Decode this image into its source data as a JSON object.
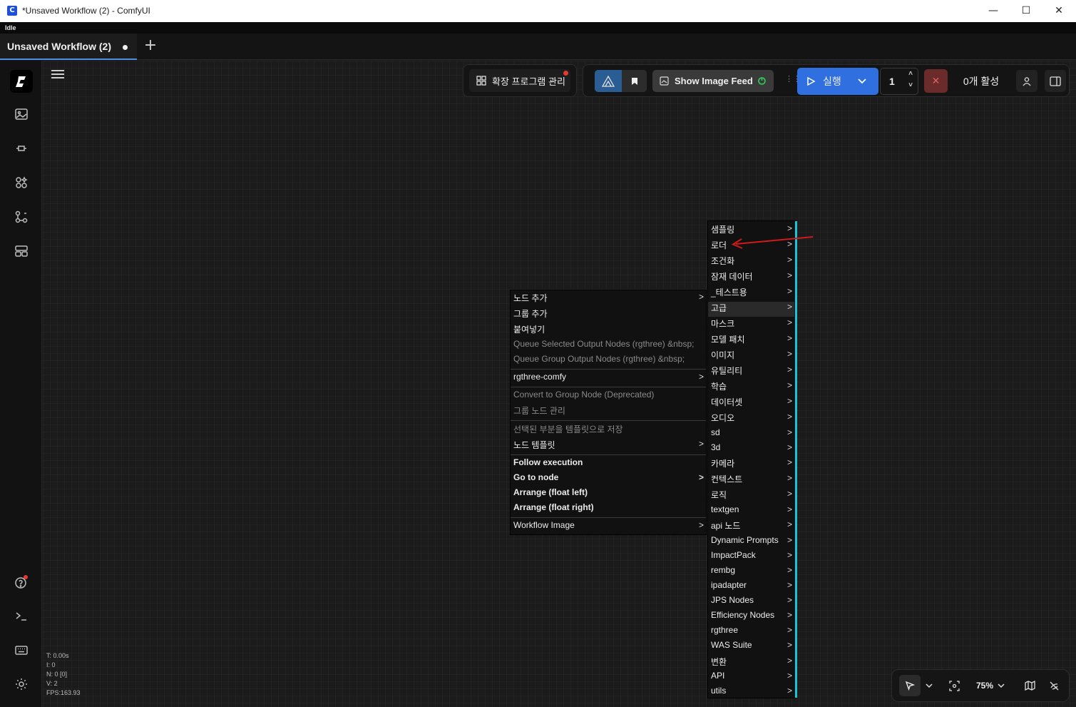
{
  "window": {
    "title": "*Unsaved Workflow (2) - ComfyUI",
    "minimize": "—",
    "maximize": "☐",
    "close": "✕"
  },
  "status": "Idle",
  "tabs": [
    {
      "label": "Unsaved Workflow (2)",
      "modified": true
    }
  ],
  "toolbar": {
    "extensions_label": "확장 프로그램 관리",
    "show_image_feed": "Show Image Feed",
    "run_label": "실행",
    "batch_count": "1",
    "active_label": "0개 활성"
  },
  "stats": {
    "t": "T: 0.00s",
    "i": "I: 0",
    "n": "N: 0 [0]",
    "v": "V: 2",
    "fps": "FPS:163.93"
  },
  "zoom": "75%",
  "context_menu": {
    "items": [
      {
        "label": "노드 추가",
        "submenu": true,
        "disabled": false
      },
      {
        "label": "그룹 추가",
        "submenu": false,
        "disabled": false
      },
      {
        "label": "붙여넣기",
        "submenu": false,
        "disabled": false
      },
      {
        "label": "Queue Selected Output Nodes (rgthree) &nbsp;",
        "submenu": false,
        "disabled": true
      },
      {
        "label": "Queue Group Output Nodes (rgthree) &nbsp;",
        "submenu": false,
        "disabled": true
      },
      {
        "label": "rgthree-comfy",
        "submenu": true,
        "disabled": false
      },
      {
        "label": "Convert to Group Node (Deprecated)",
        "submenu": false,
        "disabled": true
      },
      {
        "label": "그룹 노드 관리",
        "submenu": false,
        "disabled": true
      },
      {
        "label": "선택된 부분을 템플릿으로 저장",
        "submenu": false,
        "disabled": true
      },
      {
        "label": "노드 템플릿",
        "submenu": true,
        "disabled": false
      },
      {
        "label": "Follow execution",
        "submenu": false,
        "disabled": false
      },
      {
        "label": "Go to node",
        "submenu": true,
        "disabled": false
      },
      {
        "label": "Arrange (float left)",
        "submenu": false,
        "disabled": false
      },
      {
        "label": "Arrange (float right)",
        "submenu": false,
        "disabled": false
      },
      {
        "label": "Workflow Image",
        "submenu": true,
        "disabled": false
      }
    ],
    "submenu_arrow": ">"
  },
  "node_submenu": {
    "items": [
      "샘플링",
      "로더",
      "조건화",
      "잠재 데이터",
      "_테스트용",
      "고급",
      "마스크",
      "모델 패치",
      "이미지",
      "유틸리티",
      "학습",
      "데이터셋",
      "오디오",
      "sd",
      "3d",
      "카메라",
      "컨텍스트",
      "로직",
      "textgen",
      "api 노드",
      "Dynamic Prompts",
      "ImpactPack",
      "rembg",
      "ipadapter",
      "JPS Nodes",
      "Efficiency Nodes",
      "rgthree",
      "WAS Suite",
      "변환",
      "API",
      "utils"
    ],
    "highlighted": "고급"
  },
  "colors": {
    "accent_blue": "#1e6fe0",
    "cyan_bar": "#19c5d8",
    "stop_red": "#7a2a2a",
    "annotation_arrow": "#d11a1a"
  },
  "icons": [
    "comfy-logo-icon",
    "images-icon",
    "model-icon",
    "nodes-icon",
    "workflows-icon",
    "templates-icon",
    "help-icon",
    "terminal-icon",
    "keyboard-icon",
    "settings-icon"
  ]
}
